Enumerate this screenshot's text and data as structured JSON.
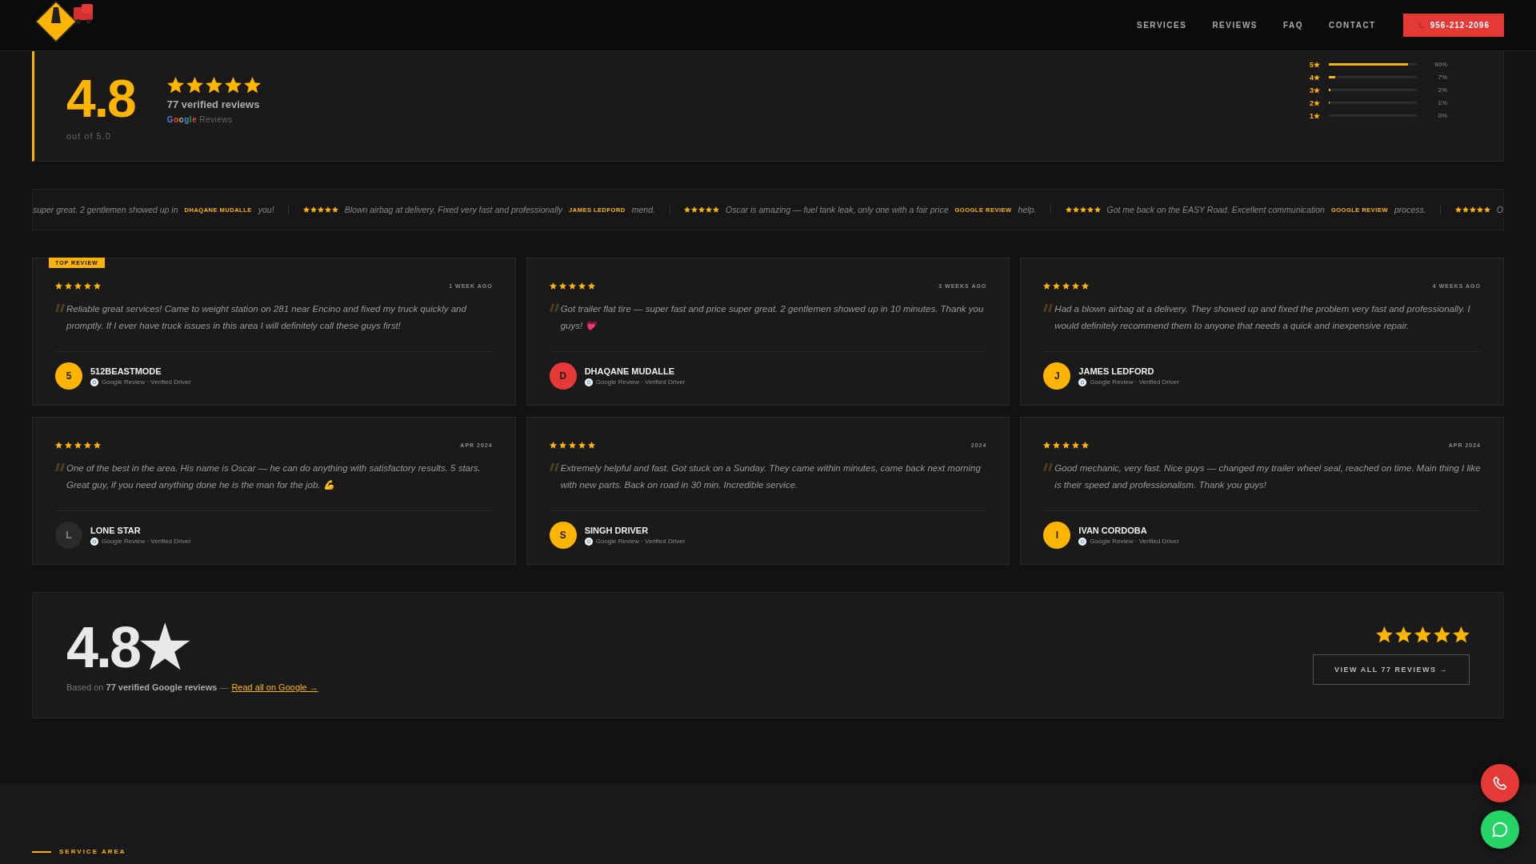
{
  "header": {
    "nav": [
      {
        "label": "SERVICES"
      },
      {
        "label": "REVIEWS"
      },
      {
        "label": "FAQ"
      },
      {
        "label": "CONTACT"
      }
    ],
    "phone_button": "956-212-2096"
  },
  "summary": {
    "score": "4.8",
    "out_of": "out of 5.0",
    "stars": 5,
    "count": "77 verified reviews",
    "source_brand": "Google",
    "source_label": "Reviews",
    "distribution": [
      {
        "label": "5★",
        "level": 0.9,
        "percent": "90%"
      },
      {
        "label": "4★",
        "level": 0.07,
        "percent": "7%"
      },
      {
        "label": "3★",
        "level": 0.02,
        "percent": "2%"
      },
      {
        "label": "2★",
        "level": 0.01,
        "percent": "1%"
      },
      {
        "label": "1★",
        "level": 0,
        "percent": "0%"
      }
    ]
  },
  "ticker": [
    {
      "quote": "super great. 2 gentlemen showed up in",
      "author": "DHAQANE MUDALLE",
      "tail": "you!"
    },
    {
      "stars": 5,
      "quote": "Blown airbag at delivery. Fixed very fast and professionally",
      "author": "JAMES LEDFORD",
      "tail": "mend."
    },
    {
      "stars": 5,
      "quote": "Oscar is amazing — fuel tank leak, only one with a fair price",
      "author": "GOOGLE REVIEW",
      "tail": "help."
    },
    {
      "stars": 5,
      "quote": "Got me back on the EASY Road. Excellent communication",
      "author": "GOOGLE REVIEW",
      "tail": "process."
    },
    {
      "stars": 5,
      "quote": "O"
    }
  ],
  "reviews": [
    {
      "badge": "TOP REVIEW",
      "stars": 5,
      "date": "1 WEEK AGO",
      "text": "Reliable great services! Came to weight station on 281 near Encino and fixed my truck quickly and promptly. If I ever have truck issues in this area I will definitely call these guys first!",
      "initial": "5",
      "color": "#ffb400",
      "name": "512BEASTMODE",
      "source": "Google Review · Verified Driver"
    },
    {
      "stars": 5,
      "date": "3 WEEKS AGO",
      "text": "Got trailer flat tire — super fast and price super great. 2 gentlemen showed up in 10 minutes. Thank you guys! 💗",
      "initial": "D",
      "color": "#e53935",
      "name": "DHAQANE MUDALLE",
      "source": "Google Review · Verified Driver"
    },
    {
      "stars": 5,
      "date": "4 WEEKS AGO",
      "text": "Had a blown airbag at a delivery. They showed up and fixed the problem very fast and professionally. I would definitely recommend them to anyone that needs a quick and inexpensive repair.",
      "initial": "J",
      "color": "#ffb400",
      "name": "JAMES LEDFORD",
      "source": "Google Review · Verified Driver"
    },
    {
      "stars": 5,
      "date": "APR 2024",
      "text": "One of the best in the area. His name is Oscar — he can do anything with satisfactory results. 5 stars. Great guy, if you need anything done he is the man for the job. 💪",
      "initial": "L",
      "color": "#2a2a2a",
      "name": "LONE STAR",
      "source": "Google Review · Verified Driver"
    },
    {
      "stars": 5,
      "date": "2024",
      "text": "Extremely helpful and fast. Got stuck on a Sunday. They came within minutes, came back next morning with new parts. Back on road in 30 min. Incredible service.",
      "initial": "S",
      "color": "#ffb400",
      "name": "SINGH DRIVER",
      "source": "Google Review · Verified Driver"
    },
    {
      "stars": 5,
      "date": "APR 2024",
      "text": "Good mechanic, very fast. Nice guys — changed my trailer wheel seal, reached on time. Main thing I like is their speed and professionalism. Thank you guys!",
      "initial": "I",
      "color": "#ffb400",
      "name": "IVAN CORDOBA",
      "source": "Google Review · Verified Driver"
    }
  ],
  "footer_summary": {
    "score": "4.8★",
    "based_on": "Based on **77 verified Google reviews** —",
    "link": "Read all on Google →",
    "stars": 5,
    "button": "VIEW ALL 77 REVIEWS →"
  },
  "next_section": {
    "eyebrow": "SERVICE AREA"
  }
}
